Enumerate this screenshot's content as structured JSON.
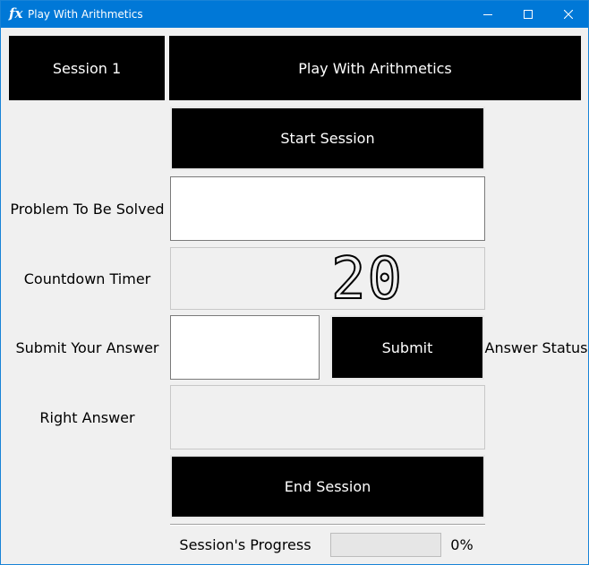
{
  "window": {
    "title": "Play With Arithmetics",
    "icon_glyph": "fx",
    "accent_color": "#0078d7"
  },
  "header": {
    "session_label": "Session 1",
    "app_title": "Play With Arithmetics"
  },
  "controls": {
    "start_label": "Start Session",
    "submit_label": "Submit",
    "end_label": "End Session"
  },
  "labels": {
    "problem": "Problem To Be Solved",
    "countdown": "Countdown Timer",
    "submit_answer": "Submit Your Answer",
    "answer_status": "Answer Status",
    "right_answer": "Right Answer",
    "progress": "Session's Progress"
  },
  "values": {
    "problem_text": "",
    "timer": "20",
    "answer_input": "",
    "right_answer": "",
    "progress_percent": 0,
    "progress_text": "0%"
  },
  "icons": {
    "app": "fx-icon",
    "minimize": "minimize-icon",
    "maximize": "maximize-icon",
    "close": "close-icon"
  }
}
